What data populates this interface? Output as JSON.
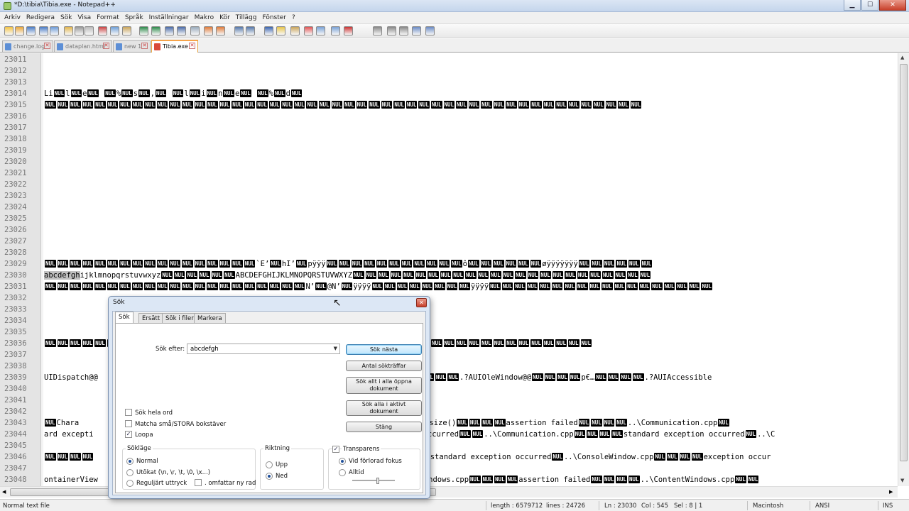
{
  "window": {
    "title": "*D:\\tibia\\Tibia.exe - Notepad++"
  },
  "menu": [
    "Arkiv",
    "Redigera",
    "Sök",
    "Visa",
    "Format",
    "Språk",
    "Inställningar",
    "Makro",
    "Kör",
    "Tillägg",
    "Fönster",
    "?"
  ],
  "tabs": [
    {
      "label": "change.log"
    },
    {
      "label": "dataplan.html"
    },
    {
      "label": "new  1"
    },
    {
      "label": "Tibia.exe"
    }
  ],
  "editor": {
    "nul_token": "NUL",
    "lines": [
      {
        "n": "23011",
        "segs": []
      },
      {
        "n": "23012",
        "segs": []
      },
      {
        "n": "23013",
        "segs": []
      },
      {
        "n": "23014",
        "segs": [
          [
            "t",
            "Li"
          ],
          [
            "n"
          ],
          [
            "t",
            "l"
          ],
          [
            "n"
          ],
          [
            "t",
            "e"
          ],
          [
            "n"
          ],
          [
            "t",
            " "
          ],
          [
            "n"
          ],
          [
            "t",
            "%"
          ],
          [
            "n"
          ],
          [
            "t",
            "s"
          ],
          [
            "n"
          ],
          [
            "t",
            ","
          ],
          [
            "n"
          ],
          [
            "t",
            " "
          ],
          [
            "n"
          ],
          [
            "t",
            "l"
          ],
          [
            "n"
          ],
          [
            "t",
            "i"
          ],
          [
            "n"
          ],
          [
            "t",
            "n"
          ],
          [
            "n"
          ],
          [
            "t",
            "e"
          ],
          [
            "n"
          ],
          [
            "t",
            " "
          ],
          [
            "n"
          ],
          [
            "t",
            "%"
          ],
          [
            "n"
          ],
          [
            "t",
            "d"
          ],
          [
            "n"
          ]
        ]
      },
      {
        "n": "23015",
        "segs": [
          [
            "r",
            48
          ]
        ]
      },
      {
        "n": "23016",
        "segs": []
      },
      {
        "n": "23017",
        "segs": []
      },
      {
        "n": "23018",
        "segs": []
      },
      {
        "n": "23019",
        "segs": []
      },
      {
        "n": "23020",
        "segs": []
      },
      {
        "n": "23021",
        "segs": []
      },
      {
        "n": "23022",
        "segs": []
      },
      {
        "n": "23023",
        "segs": []
      },
      {
        "n": "23024",
        "segs": []
      },
      {
        "n": "23025",
        "segs": []
      },
      {
        "n": "23026",
        "segs": []
      },
      {
        "n": "23027",
        "segs": []
      },
      {
        "n": "23028",
        "segs": []
      },
      {
        "n": "23029",
        "segs": [
          [
            "r",
            17
          ],
          [
            "t",
            "`E’"
          ],
          [
            "n"
          ],
          [
            "t",
            "hI’"
          ],
          [
            "n"
          ],
          [
            "t",
            "pÿÿÿ"
          ],
          [
            "r",
            11
          ],
          [
            "t",
            "ô"
          ],
          [
            "r",
            6
          ],
          [
            "t",
            "øÿÿÿÿÿÿÿ"
          ],
          [
            "r",
            6
          ]
        ]
      },
      {
        "n": "23030",
        "segs": [
          [
            "s",
            "abcdefgh"
          ],
          [
            "t",
            "ijklmnopqrstuvwxyz"
          ],
          [
            "r",
            6
          ],
          [
            "t",
            "ABCDEFGHIJKLMNOPQRSTUVWXYZ"
          ],
          [
            "r",
            24
          ]
        ]
      },
      {
        "n": "23031",
        "segs": [
          [
            "r",
            21
          ],
          [
            "t",
            "N’"
          ],
          [
            "n"
          ],
          [
            "t",
            "@N’"
          ],
          [
            "n"
          ],
          [
            "t",
            "ÿÿÿÿ"
          ],
          [
            "r",
            8
          ],
          [
            "t",
            "ÿÿÿÿ"
          ],
          [
            "r",
            18
          ]
        ]
      },
      {
        "n": "23032",
        "segs": []
      },
      {
        "n": "23033",
        "segs": []
      },
      {
        "n": "23034",
        "segs": []
      },
      {
        "n": "23035",
        "segs": []
      },
      {
        "n": "23036",
        "segs": [
          [
            "r",
            44
          ]
        ]
      },
      {
        "n": "23037",
        "segs": []
      },
      {
        "n": "23038",
        "segs": []
      },
      {
        "n": "23039",
        "segs": [
          [
            "t",
            "UIDispatch@@"
          ],
          [
            "g",
            420
          ],
          [
            "t",
            "p€…"
          ],
          [
            "r",
            4
          ],
          [
            "t",
            ".?AUIOleWindow@@"
          ],
          [
            "r",
            4
          ],
          [
            "t",
            "p€…"
          ],
          [
            "r",
            4
          ],
          [
            "t",
            ".?AUIAccessible"
          ]
        ]
      },
      {
        "n": "23040",
        "segs": []
      },
      {
        "n": "23041",
        "segs": []
      },
      {
        "n": "23042",
        "segs": []
      },
      {
        "n": "23043",
        "segs": [
          [
            "n"
          ],
          [
            "t",
            "Chara"
          ],
          [
            "g",
            430
          ],
          [
            "t",
            "acterName.size()"
          ],
          [
            "r",
            4
          ],
          [
            "t",
            "assertion failed"
          ],
          [
            "r",
            4
          ],
          [
            "t",
            "..\\Communication.cpp"
          ],
          [
            "n"
          ]
        ]
      },
      {
        "n": "23044",
        "segs": [
          [
            "t",
            "ard excepti"
          ],
          [
            "g",
            464
          ],
          [
            "t",
            "occurred"
          ],
          [
            "r",
            2
          ],
          [
            "t",
            "..\\Communication.cpp"
          ],
          [
            "r",
            4
          ],
          [
            "t",
            "standard exception occurred"
          ],
          [
            "n"
          ],
          [
            "t",
            "..\\C"
          ]
        ]
      },
      {
        "n": "23045",
        "segs": []
      },
      {
        "n": "23046",
        "segs": [
          [
            "r",
            4
          ],
          [
            "g",
            456
          ],
          [
            "n"
          ],
          [
            "t",
            "standard exception occurred"
          ],
          [
            "n"
          ],
          [
            "t",
            "..\\ConsoleWindow.cpp"
          ],
          [
            "r",
            4
          ],
          [
            "t",
            "exception occur"
          ]
        ]
      },
      {
        "n": "23047",
        "segs": []
      },
      {
        "n": "23048",
        "segs": [
          [
            "t",
            "ontainerView"
          ],
          [
            "g",
            440
          ],
          [
            "t",
            "ntWindows.cpp"
          ],
          [
            "r",
            4
          ],
          [
            "t",
            "assertion failed"
          ],
          [
            "r",
            4
          ],
          [
            "t",
            "..\\ContentWindows.cpp"
          ],
          [
            "r",
            2
          ]
        ]
      }
    ]
  },
  "status": {
    "filetype": "Normal text file",
    "length": "length : 6579712",
    "lines": "lines : 24726",
    "ln": "Ln : 23030",
    "col": "Col : 545",
    "sel": "Sel : 8 | 1",
    "eol": "Macintosh",
    "encoding": "ANSI",
    "mode": "INS"
  },
  "find_dialog": {
    "title": "Sök",
    "tabs": [
      "Sök",
      "Ersätt",
      "Sök i filer",
      "Markera"
    ],
    "find_label": "Sök efter:",
    "find_value": "abcdefgh",
    "buttons": {
      "find_next": "Sök nästa",
      "count": "Antal sökträffar",
      "find_all_open": "Sök allt i alla öppna dokument",
      "find_all_current": "Sök alla i aktivt dokument",
      "close": "Stäng"
    },
    "options": {
      "whole_word": {
        "label": "Sök hela ord",
        "checked": false
      },
      "match_case": {
        "label": "Matcha små/STORA bokstäver",
        "checked": false
      },
      "wrap": {
        "label": "Loopa",
        "checked": true
      }
    },
    "search_mode": {
      "title": "Sökläge",
      "normal": "Normal",
      "extended": "Utökat (\\n, \\r, \\t, \\0, \\x...)",
      "regex": "Reguljärt uttryck",
      "dot_newline": ". omfattar ny rad",
      "selected": "normal"
    },
    "direction": {
      "title": "Riktning",
      "up": "Upp",
      "down": "Ned",
      "selected": "down"
    },
    "transparency": {
      "title": "Transparens",
      "enabled": true,
      "on_lose_focus": "Vid förlorad fokus",
      "always": "Alltid",
      "selected": "on_lose_focus",
      "level": 0.6
    }
  }
}
